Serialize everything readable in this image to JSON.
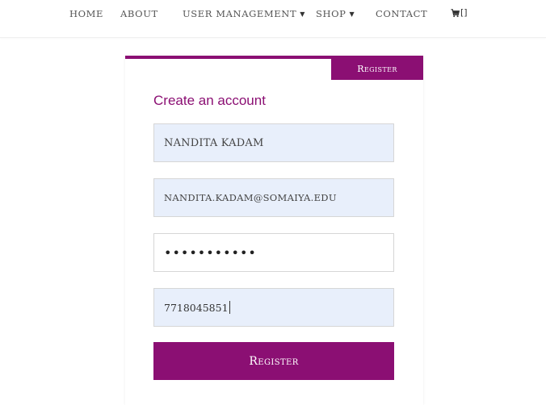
{
  "nav": {
    "home": "Home",
    "about": "About",
    "user_management": "User Management",
    "shop": "Shop",
    "contact": "Contact",
    "cart_count": "[]"
  },
  "card": {
    "tab_label": "Register",
    "title": "Create an account",
    "accent_color": "#8b0f73"
  },
  "form": {
    "name_value": "Nandita kadam",
    "email_value": "nandita.kadam@somaiya.edu",
    "password_value": "•••••••••••",
    "phone_value": "7718045851",
    "submit_label": "Register"
  }
}
